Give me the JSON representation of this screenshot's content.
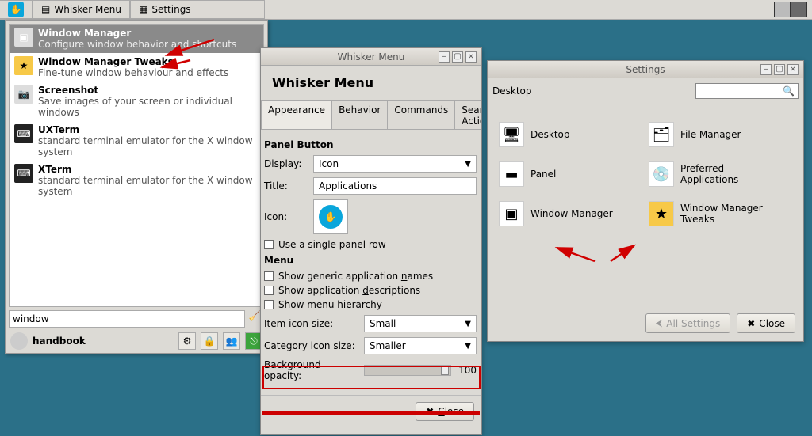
{
  "panel": {
    "btn1": "Whisker Menu",
    "btn2": "Settings"
  },
  "whisker_menu": {
    "items": [
      {
        "title": "Window Manager",
        "desc": "Configure window behavior and shortcuts"
      },
      {
        "title": "Window Manager Tweaks",
        "desc": "Fine-tune window behaviour and effects"
      },
      {
        "title": "Screenshot",
        "desc": "Save images of your screen or individual windows"
      },
      {
        "title": "UXTerm",
        "desc": "standard terminal emulator for the X window system"
      },
      {
        "title": "XTerm",
        "desc": "standard terminal emulator for the X window system"
      }
    ],
    "search_value": "window",
    "user": "handbook"
  },
  "wm_settings": {
    "win_title": "Whisker Menu",
    "header": "Whisker Menu",
    "tabs": [
      "Appearance",
      "Behavior",
      "Commands",
      "Search Actions"
    ],
    "section_panel": "Panel Button",
    "display_label": "Display:",
    "display_value": "Icon",
    "title_label": "Title:",
    "title_value": "Applications",
    "icon_label": "Icon:",
    "single_row": "Use a single panel row",
    "section_menu": "Menu",
    "chk_generic": "Show generic application names",
    "chk_desc": "Show application descriptions",
    "chk_hier": "Show menu hierarchy",
    "item_icon_label": "Item icon size:",
    "item_icon_value": "Small",
    "cat_icon_label": "Category icon size:",
    "cat_icon_value": "Smaller",
    "bg_opacity_label": "Background opacity:",
    "bg_opacity_value": "100",
    "close": "Close"
  },
  "settings": {
    "win_title": "Settings",
    "crumb": "Desktop",
    "items": [
      {
        "label": "Desktop"
      },
      {
        "label": "File Manager"
      },
      {
        "label": "Panel"
      },
      {
        "label": "Preferred Applications"
      },
      {
        "label": "Window Manager"
      },
      {
        "label": "Window Manager Tweaks"
      }
    ],
    "all_settings": "All Settings",
    "close": "Close"
  }
}
